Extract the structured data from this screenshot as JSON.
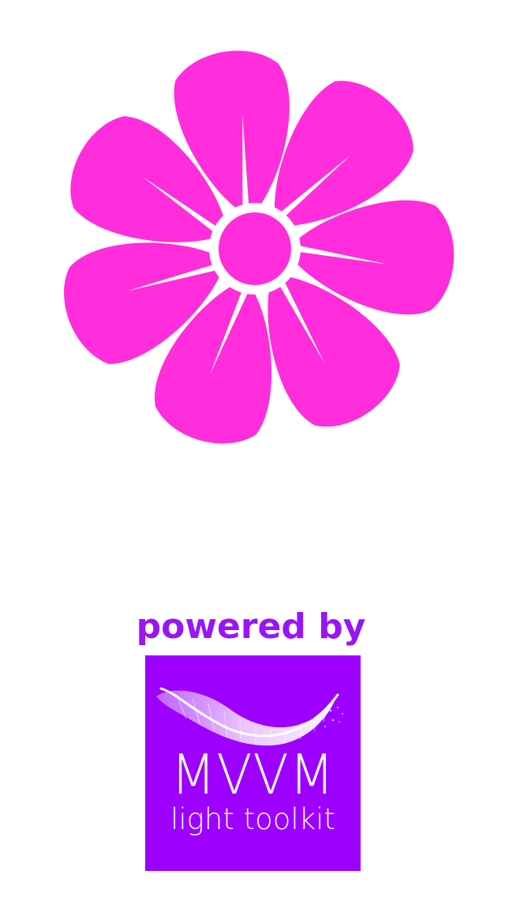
{
  "splash": {
    "accent_color": "#ff2ddb",
    "logo_background": "#9d00ff",
    "powered_by_color": "#9a15f6",
    "powered_by": "powered by",
    "logo_title": "MVVM",
    "logo_subtitle": "light toolkit"
  }
}
